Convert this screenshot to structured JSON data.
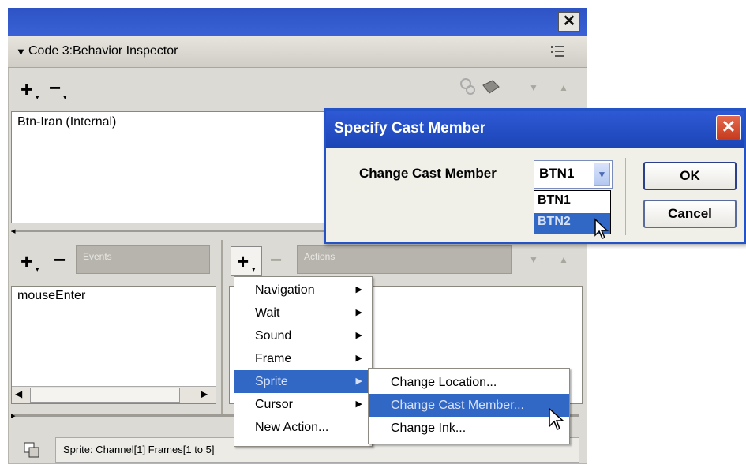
{
  "window": {
    "close_glyph": "✕"
  },
  "inspector": {
    "title": "Code 3:Behavior Inspector",
    "options_icon": "menu-options-icon",
    "behavior_list": [
      "Btn-Iran (Internal)"
    ],
    "events_label": "Events",
    "actions_label": "Actions",
    "events_list": [
      "mouseEnter"
    ],
    "status_text": "Sprite:  Channel[1]  Frames[1 to 5]"
  },
  "dialog": {
    "title": "Specify Cast Member",
    "field_label": "Change Cast Member",
    "selected_value": "BTN1",
    "options": [
      "BTN1",
      "BTN2"
    ],
    "highlighted_option": "BTN2",
    "ok_label": "OK",
    "cancel_label": "Cancel"
  },
  "action_menu": {
    "items": [
      {
        "label": "Navigation",
        "submenu": true
      },
      {
        "label": "Wait",
        "submenu": true
      },
      {
        "label": "Sound",
        "submenu": true
      },
      {
        "label": "Frame",
        "submenu": true
      },
      {
        "label": "Sprite",
        "submenu": true
      },
      {
        "label": "Cursor",
        "submenu": true
      },
      {
        "label": "New Action...",
        "submenu": false
      }
    ],
    "selected": "Sprite"
  },
  "sprite_submenu": {
    "items": [
      "Change Location...",
      "Change Cast Member...",
      "Change Ink..."
    ],
    "selected": "Change Cast Member..."
  },
  "colors": {
    "titlebar": "#2e53c4",
    "selection": "#3168c6",
    "panel": "#dcdad4"
  }
}
